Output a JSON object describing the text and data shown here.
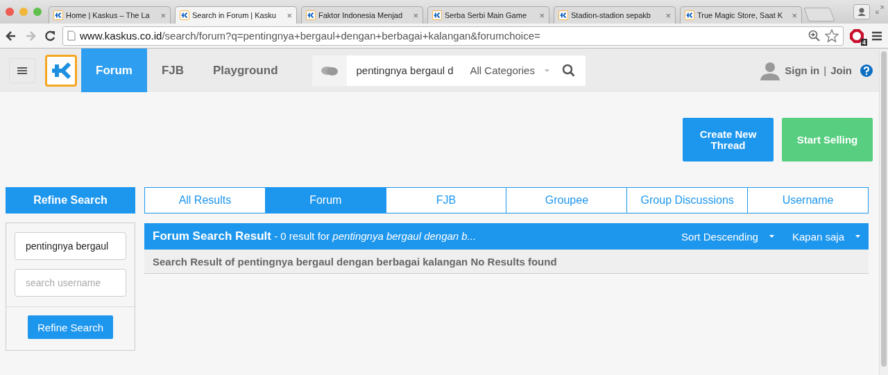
{
  "browser": {
    "tabs": [
      {
        "title": "Home | Kaskus – The La",
        "close": "×",
        "selected": false
      },
      {
        "title": "Search in Forum | Kasku",
        "close": "×",
        "selected": true
      },
      {
        "title": "Faktor Indonesia Menjad",
        "close": "×",
        "selected": false
      },
      {
        "title": "Serba Serbi Main Game",
        "close": "×",
        "selected": false
      },
      {
        "title": "Stadion-stadion sepakb",
        "close": "×",
        "selected": false
      },
      {
        "title": "True Magic Store, Saat K",
        "close": "×",
        "selected": false
      }
    ],
    "url_host": "www.kaskus.co.id",
    "url_path": "/search/forum?q=pentingnya+bergaul+dengan+berbagai+kalangan&forumchoice=",
    "extension_badge": "4"
  },
  "header": {
    "nav": [
      {
        "label": "Forum",
        "selected": true
      },
      {
        "label": "FJB",
        "selected": false
      },
      {
        "label": "Playground",
        "selected": false
      }
    ],
    "search_value": "pentingnya bergaul d",
    "category": "All Categories",
    "sign_in": "Sign in",
    "separator": "|",
    "join": "Join"
  },
  "actions": [
    "Create New Thread",
    "Start Selling"
  ],
  "sidebar": {
    "title": "Refine Search",
    "keyword_value": "pentingnya bergaul",
    "username_placeholder": "search username",
    "button": "Refine Search"
  },
  "result_tabs": [
    {
      "label": "All Results",
      "selected": false
    },
    {
      "label": "Forum",
      "selected": true
    },
    {
      "label": "FJB",
      "selected": false
    },
    {
      "label": "Groupee",
      "selected": false
    },
    {
      "label": "Group Discussions",
      "selected": false
    },
    {
      "label": "Username",
      "selected": false
    }
  ],
  "results": {
    "heading": "**Forum Search Result** - 0 result for *pentingnya bergaul dengan b...*",
    "sort": "Sort Descending",
    "time": "Kapan saja",
    "message": "Search Result of pentingnya bergaul dengan berbagai kalangan No Results found"
  }
}
